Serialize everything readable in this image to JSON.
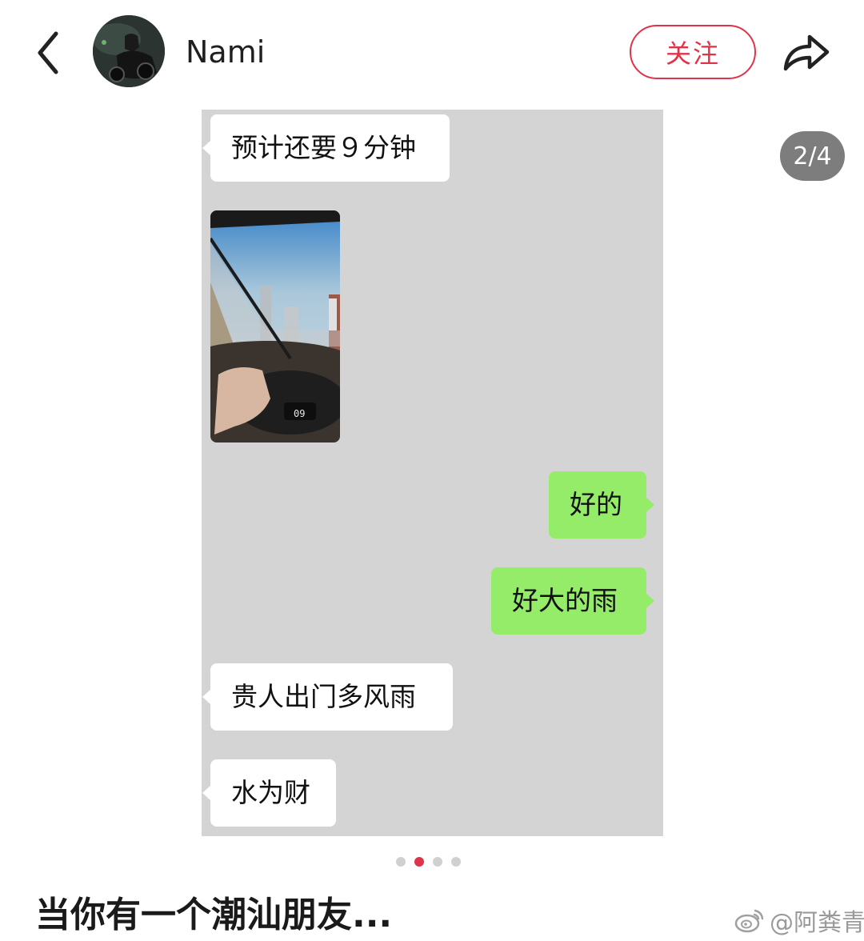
{
  "header": {
    "back_icon": "chevron-left-icon",
    "username": "Nami",
    "follow_label": "关注",
    "share_icon": "share-arrow-icon",
    "accent_color": "#e0334a"
  },
  "gallery": {
    "counter": "2/4",
    "current_index": 2,
    "total": 4
  },
  "chat": {
    "messages": [
      {
        "side": "left",
        "text": "预计还要９分钟"
      },
      {
        "side": "left",
        "type": "image",
        "icon": "driving-photo"
      },
      {
        "side": "right",
        "text": "好的"
      },
      {
        "side": "right",
        "text": "好大的雨"
      },
      {
        "side": "left",
        "text": "贵人出门多风雨"
      },
      {
        "side": "left",
        "text": "水为财"
      }
    ],
    "photo_dashboard_text": "09",
    "incoming_bubble_color": "#ffffff",
    "outgoing_bubble_color": "#95ec69"
  },
  "caption": "当你有一个潮汕朋友...",
  "watermark": {
    "icon": "weibo-logo-icon",
    "text": "@阿粪青"
  }
}
